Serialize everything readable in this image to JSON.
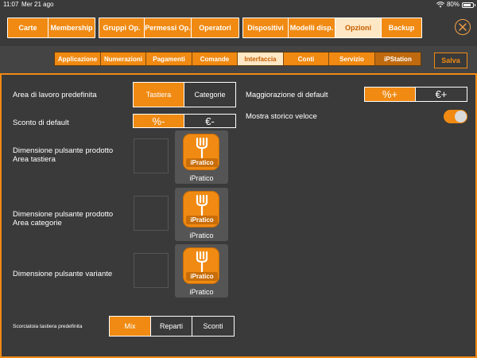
{
  "status_bar": {
    "time": "11:07",
    "date": "Mer 21 ago",
    "battery": "80%",
    "battery_level": 0.8
  },
  "top_nav": {
    "groups": [
      [
        "Carte",
        "Membership"
      ],
      [
        "Gruppi Op.",
        "Permessi Op.",
        "Operatori"
      ],
      [
        "Dispositivi",
        "Modelli disp.",
        "Opzioni",
        "Backup"
      ]
    ],
    "active": "Opzioni"
  },
  "sub_nav": {
    "tabs": [
      "Applicazione",
      "Numerazioni",
      "Pagamenti",
      "Comande",
      "Interfaccia",
      "Conti",
      "Servizio",
      "iPStation"
    ],
    "active": "Interfaccia",
    "save_label": "Salva"
  },
  "settings": {
    "workspace": {
      "label": "Area di lavoro predefinita",
      "options": [
        "Tastiera",
        "Categorie"
      ],
      "selected": "Tastiera"
    },
    "discount": {
      "label": "Sconto di default",
      "options": [
        "%-",
        "€-"
      ],
      "selected": "%-"
    },
    "product_btn_keyboard": {
      "label_line1": "Dimensione pulsante prodotto",
      "label_line2": "Area tastiera"
    },
    "product_btn_categories": {
      "label_line1": "Dimensione pulsante prodotto",
      "label_line2": "Area categorie"
    },
    "variant_btn": {
      "label": "Dimensione pulsante variante"
    },
    "keyboard_shortcut": {
      "label": "Scorciatoia tastiera predefinita",
      "options": [
        "Mix",
        "Reparti",
        "Sconti"
      ],
      "selected": "Mix"
    },
    "surcharge": {
      "label": "Maggiorazione di default",
      "options": [
        "%+",
        "€+"
      ],
      "selected": "%+"
    },
    "fast_history": {
      "label": "Mostra storico veloce",
      "enabled": true
    },
    "preview": {
      "logo_text": "iPratico",
      "caption": "iPratico"
    }
  },
  "colors": {
    "accent": "#f08a12",
    "background": "#3a3a3a",
    "active_tab": "#fde7c4"
  }
}
